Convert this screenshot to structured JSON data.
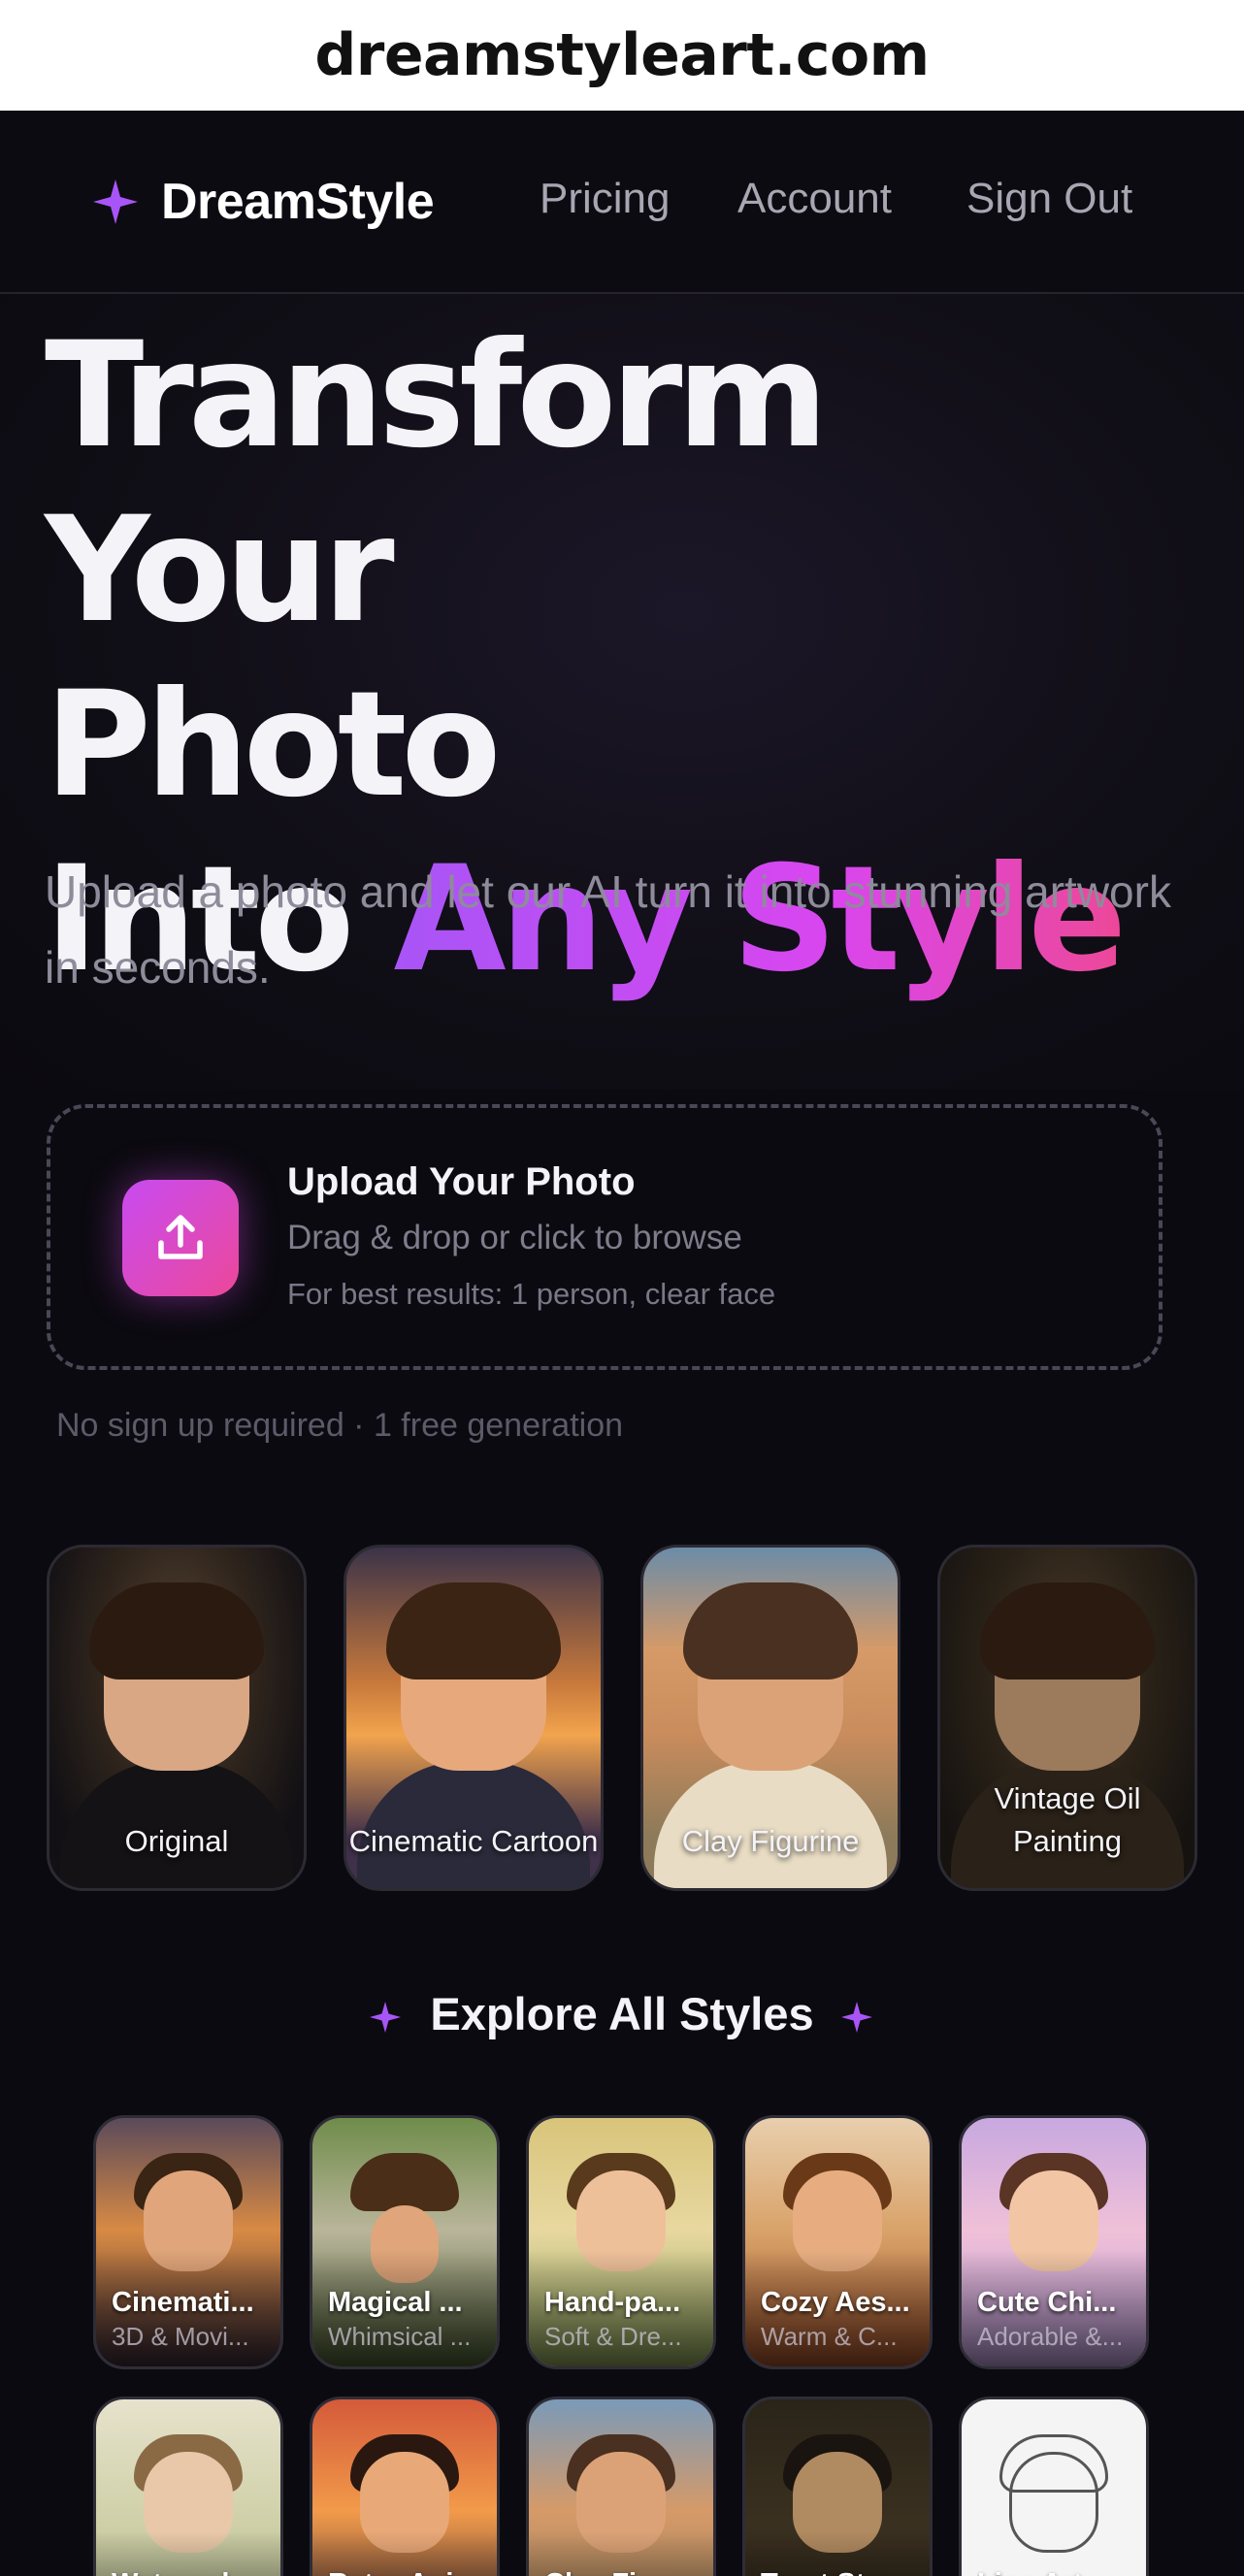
{
  "browser": {
    "url": "dreamstyleart.com"
  },
  "nav": {
    "brand": "DreamStyle",
    "links": [
      "Pricing",
      "Account",
      "Sign Out"
    ]
  },
  "hero": {
    "title_line1": "Transform Your",
    "title_line2": "Photo",
    "title_line3_plain": "Into ",
    "title_line3_accent": "Any Style",
    "subtitle": "Upload a photo and let our AI turn it into stunning artwork in seconds."
  },
  "upload": {
    "title": "Upload Your Photo",
    "hint": "Drag & drop or click to browse",
    "note": "For best results: 1 person, clear face",
    "free_note": "No sign up required · 1 free generation"
  },
  "compare": [
    {
      "label": "Original"
    },
    {
      "label": "Cinematic Cartoon"
    },
    {
      "label": "Clay Figurine"
    },
    {
      "label": "Vintage Oil Painting"
    }
  ],
  "explore": {
    "heading": "Explore All Styles"
  },
  "styles": [
    {
      "name": "Cinemati...",
      "sub": "3D & Movi..."
    },
    {
      "name": "Magical ...",
      "sub": "Whimsical ..."
    },
    {
      "name": "Hand-pa...",
      "sub": "Soft & Dre..."
    },
    {
      "name": "Cozy Aes...",
      "sub": "Warm & C..."
    },
    {
      "name": "Cute Chi...",
      "sub": "Adorable &..."
    },
    {
      "name": "Watercol...",
      "sub": ""
    },
    {
      "name": "Retro Ani...",
      "sub": ""
    },
    {
      "name": "Clay Figu...",
      "sub": ""
    },
    {
      "name": "Tarot Sty...",
      "sub": ""
    },
    {
      "name": "Line Art ...",
      "sub": ""
    }
  ],
  "colors": {
    "accent_purple": "#a855f7",
    "accent_pink": "#ec4899",
    "background": "#0b0a10"
  }
}
